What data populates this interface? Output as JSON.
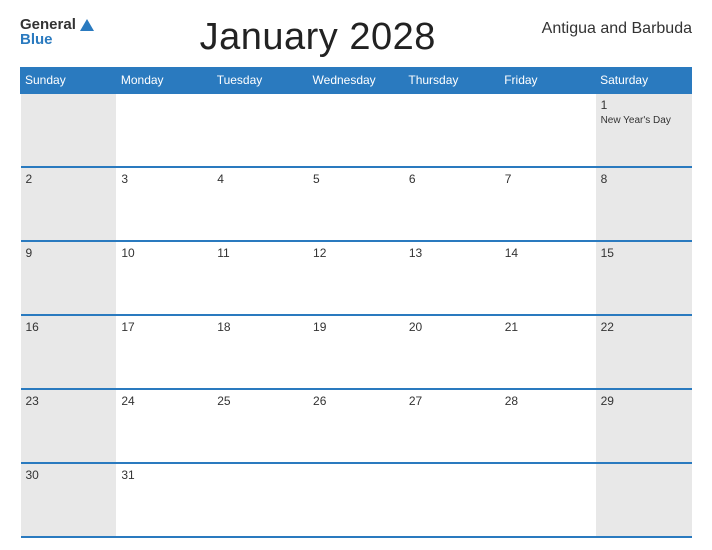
{
  "header": {
    "logo": {
      "general": "General",
      "blue": "Blue"
    },
    "title": "January 2028",
    "country": "Antigua and Barbuda"
  },
  "weekdays": [
    "Sunday",
    "Monday",
    "Tuesday",
    "Wednesday",
    "Thursday",
    "Friday",
    "Saturday"
  ],
  "weeks": [
    [
      {
        "day": "",
        "holiday": ""
      },
      {
        "day": "",
        "holiday": ""
      },
      {
        "day": "",
        "holiday": ""
      },
      {
        "day": "",
        "holiday": ""
      },
      {
        "day": "",
        "holiday": ""
      },
      {
        "day": "",
        "holiday": ""
      },
      {
        "day": "1",
        "holiday": "New Year's Day"
      }
    ],
    [
      {
        "day": "2",
        "holiday": ""
      },
      {
        "day": "3",
        "holiday": ""
      },
      {
        "day": "4",
        "holiday": ""
      },
      {
        "day": "5",
        "holiday": ""
      },
      {
        "day": "6",
        "holiday": ""
      },
      {
        "day": "7",
        "holiday": ""
      },
      {
        "day": "8",
        "holiday": ""
      }
    ],
    [
      {
        "day": "9",
        "holiday": ""
      },
      {
        "day": "10",
        "holiday": ""
      },
      {
        "day": "11",
        "holiday": ""
      },
      {
        "day": "12",
        "holiday": ""
      },
      {
        "day": "13",
        "holiday": ""
      },
      {
        "day": "14",
        "holiday": ""
      },
      {
        "day": "15",
        "holiday": ""
      }
    ],
    [
      {
        "day": "16",
        "holiday": ""
      },
      {
        "day": "17",
        "holiday": ""
      },
      {
        "day": "18",
        "holiday": ""
      },
      {
        "day": "19",
        "holiday": ""
      },
      {
        "day": "20",
        "holiday": ""
      },
      {
        "day": "21",
        "holiday": ""
      },
      {
        "day": "22",
        "holiday": ""
      }
    ],
    [
      {
        "day": "23",
        "holiday": ""
      },
      {
        "day": "24",
        "holiday": ""
      },
      {
        "day": "25",
        "holiday": ""
      },
      {
        "day": "26",
        "holiday": ""
      },
      {
        "day": "27",
        "holiday": ""
      },
      {
        "day": "28",
        "holiday": ""
      },
      {
        "day": "29",
        "holiday": ""
      }
    ],
    [
      {
        "day": "30",
        "holiday": ""
      },
      {
        "day": "31",
        "holiday": ""
      },
      {
        "day": "",
        "holiday": ""
      },
      {
        "day": "",
        "holiday": ""
      },
      {
        "day": "",
        "holiday": ""
      },
      {
        "day": "",
        "holiday": ""
      },
      {
        "day": "",
        "holiday": ""
      }
    ]
  ],
  "colors": {
    "header_bg": "#2a7abf",
    "saturday_bg": "#e8e8e8",
    "sunday_bg": "#e8e8e8"
  }
}
